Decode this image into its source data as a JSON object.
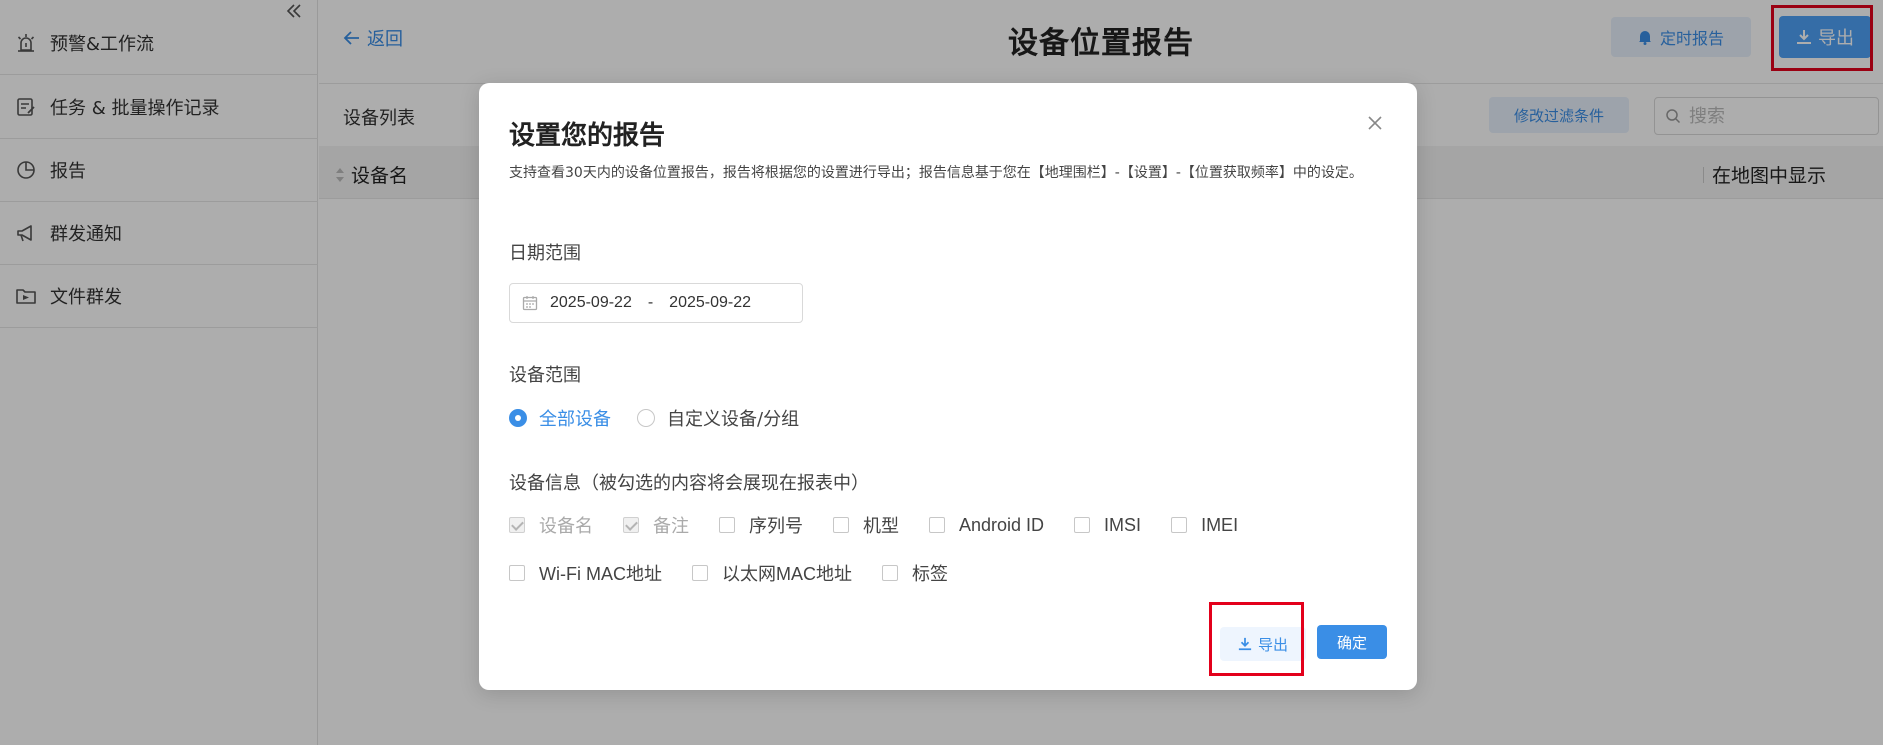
{
  "sidebar": {
    "items": [
      {
        "label": "预警&工作流",
        "icon": "alarm-icon"
      },
      {
        "label": "任务 & 批量操作记录",
        "icon": "task-list-icon"
      },
      {
        "label": "报告",
        "icon": "pie-chart-icon"
      },
      {
        "label": "群发通知",
        "icon": "megaphone-icon"
      },
      {
        "label": "文件群发",
        "icon": "folder-send-icon"
      }
    ]
  },
  "header": {
    "back_label": "返回",
    "title": "设备位置报告",
    "scheduled_report_label": "定时报告",
    "export_label": "导出"
  },
  "list": {
    "title": "设备列表",
    "filter_button": "修改过滤条件",
    "search_placeholder": "搜索",
    "columns": [
      "设备名",
      "在地图中显示"
    ]
  },
  "modal": {
    "title": "设置您的报告",
    "description": "支持查看30天内的设备位置报告，报告将根据您的设置进行导出；报告信息基于您在【地理围栏】-【设置】-【位置获取频率】中的设定。",
    "date_range": {
      "label": "日期范围",
      "start": "2025-09-22",
      "separator": "-",
      "end": "2025-09-22"
    },
    "device_scope": {
      "label": "设备范围",
      "options": [
        {
          "label": "全部设备",
          "checked": true
        },
        {
          "label": "自定义设备/分组",
          "checked": false
        }
      ]
    },
    "device_info": {
      "label": "设备信息（被勾选的内容将会展现在报表中）",
      "row1": [
        "设备名",
        "备注",
        "序列号",
        "机型",
        "Android ID",
        "IMSI",
        "IMEI"
      ],
      "row2": [
        "Wi-Fi MAC地址",
        "以太网MAC地址",
        "标签"
      ]
    },
    "export_label": "导出",
    "confirm_label": "确定"
  },
  "colors": {
    "accent": "#3a8ee6",
    "highlight_box": "#e3001b"
  }
}
